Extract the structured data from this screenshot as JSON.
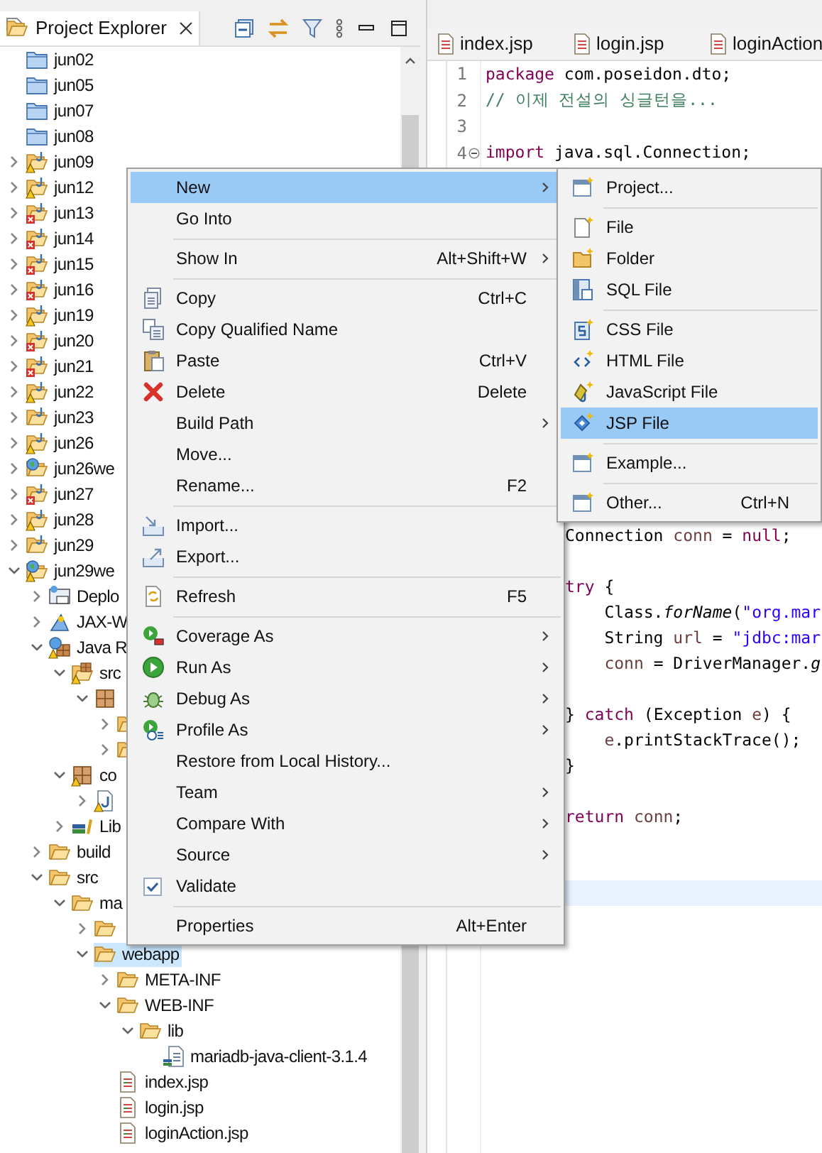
{
  "explorer": {
    "title": "Project Explorer",
    "tree": [
      {
        "label": "jun02",
        "kind": "closed-project",
        "selected": false
      },
      {
        "label": "jun05",
        "kind": "closed-project",
        "selected": false
      },
      {
        "label": "jun07",
        "kind": "closed-project",
        "selected": false
      },
      {
        "label": "jun08",
        "kind": "closed-project",
        "selected": false
      },
      {
        "label": "jun09",
        "kind": "project",
        "warning": true,
        "error": false,
        "expanded": false,
        "selected": false
      },
      {
        "label": "jun12",
        "kind": "project",
        "warning": true,
        "error": false,
        "expanded": false,
        "selected": false
      },
      {
        "label": "jun13",
        "kind": "project",
        "warning": false,
        "error": true,
        "expanded": false,
        "selected": false
      },
      {
        "label": "jun14",
        "kind": "project",
        "warning": false,
        "error": true,
        "expanded": false,
        "selected": false
      },
      {
        "label": "jun15",
        "kind": "project",
        "warning": false,
        "error": true,
        "expanded": false,
        "selected": false
      },
      {
        "label": "jun16",
        "kind": "project",
        "warning": false,
        "error": true,
        "expanded": false,
        "selected": false
      },
      {
        "label": "jun19",
        "kind": "project",
        "warning": true,
        "error": false,
        "expanded": false,
        "selected": false
      },
      {
        "label": "jun20",
        "kind": "project",
        "warning": false,
        "error": true,
        "expanded": false,
        "selected": false
      },
      {
        "label": "jun21",
        "kind": "project",
        "warning": false,
        "error": true,
        "expanded": false,
        "selected": false
      },
      {
        "label": "jun22",
        "kind": "project",
        "warning": true,
        "error": false,
        "expanded": false,
        "selected": false
      },
      {
        "label": "jun23",
        "kind": "project",
        "warning": false,
        "error": false,
        "expanded": false,
        "selected": false
      },
      {
        "label": "jun26",
        "kind": "project",
        "warning": true,
        "error": false,
        "expanded": false,
        "selected": false
      },
      {
        "label": "jun26we",
        "kind": "web-project",
        "warning": false,
        "error": false,
        "expanded": false,
        "selected": false
      },
      {
        "label": "jun27",
        "kind": "project",
        "warning": false,
        "error": true,
        "expanded": false,
        "selected": false
      },
      {
        "label": "jun28",
        "kind": "project",
        "warning": true,
        "error": false,
        "expanded": false,
        "selected": false
      },
      {
        "label": "jun29",
        "kind": "project",
        "warning": false,
        "error": false,
        "expanded": false,
        "selected": false
      },
      {
        "label": "jun29we",
        "kind": "web-project",
        "warning": true,
        "error": false,
        "expanded": true,
        "selected": false,
        "children": [
          {
            "label": "Deplo",
            "kind": "deploy",
            "warning": false,
            "error": false,
            "expanded": false,
            "selected": false
          },
          {
            "label": "JAX-W",
            "kind": "jax",
            "warning": false,
            "error": false,
            "expanded": false,
            "selected": false
          },
          {
            "label": "Java R",
            "kind": "java-resources",
            "warning": true,
            "error": false,
            "expanded": true,
            "selected": false,
            "children": [
              {
                "label": "src",
                "kind": "source-folder",
                "warning": true,
                "error": false,
                "expanded": true,
                "selected": false,
                "children": [
                  {
                    "kind": "package",
                    "warning": false,
                    "error": false,
                    "expanded": true,
                    "selected": false,
                    "children": [
                      {
                        "kind": "package-folder",
                        "warning": false,
                        "error": false,
                        "expanded": false,
                        "selected": false
                      },
                      {
                        "kind": "package-folder",
                        "warning": false,
                        "error": false,
                        "expanded": false,
                        "selected": false
                      }
                    ]
                  }
                ]
              },
              {
                "label": "co",
                "kind": "package",
                "warning": true,
                "error": false,
                "expanded": true,
                "selected": false,
                "children": [
                  {
                    "kind": "java-file",
                    "warning": true,
                    "error": false,
                    "expanded": false,
                    "selected": false
                  }
                ]
              },
              {
                "label": "Lib",
                "kind": "library",
                "warning": false,
                "error": false,
                "expanded": false,
                "selected": false
              }
            ]
          },
          {
            "label": "build",
            "kind": "folder",
            "warning": false,
            "error": false,
            "expanded": false,
            "selected": false
          },
          {
            "label": "src",
            "kind": "folder",
            "warning": false,
            "error": false,
            "expanded": true,
            "selected": false,
            "children": [
              {
                "label": "ma",
                "kind": "folder",
                "warning": false,
                "error": false,
                "expanded": true,
                "selected": false,
                "children": [
                  {
                    "kind": "folder",
                    "warning": false,
                    "error": false,
                    "expanded": false,
                    "selected": false
                  },
                  {
                    "label": "webapp",
                    "kind": "folder",
                    "warning": false,
                    "error": false,
                    "expanded": true,
                    "selected": true,
                    "children": [
                      {
                        "label": "META-INF",
                        "kind": "folder",
                        "warning": false,
                        "error": false,
                        "expanded": false,
                        "selected": false
                      },
                      {
                        "label": "WEB-INF",
                        "kind": "folder",
                        "warning": false,
                        "error": false,
                        "expanded": true,
                        "selected": false,
                        "children": [
                          {
                            "label": "lib",
                            "kind": "folder",
                            "warning": false,
                            "error": false,
                            "expanded": true,
                            "selected": false,
                            "children": [
                              {
                                "label": "mariadb-java-client-3.1.4",
                                "kind": "jar",
                                "warning": false,
                                "error": false,
                                "selected": false
                              }
                            ]
                          }
                        ]
                      },
                      {
                        "label": "index.jsp",
                        "kind": "jsp",
                        "warning": false,
                        "error": false,
                        "selected": false
                      },
                      {
                        "label": "login.jsp",
                        "kind": "jsp",
                        "warning": false,
                        "error": false,
                        "selected": false
                      },
                      {
                        "label": "loginAction.jsp",
                        "kind": "jsp",
                        "warning": false,
                        "error": false,
                        "selected": false
                      }
                    ]
                  }
                ]
              }
            ]
          }
        ]
      }
    ]
  },
  "editor": {
    "tabs": [
      {
        "label": "index.jsp"
      },
      {
        "label": "login.jsp"
      },
      {
        "label": "loginAction"
      }
    ],
    "top_lines": [
      {
        "number": "1",
        "fold": false,
        "tokens": [
          {
            "text": "package",
            "kind": "keyword"
          },
          {
            "text": " com.poseidon.dto;",
            "kind": "plain"
          }
        ]
      },
      {
        "number": "2",
        "fold": false,
        "tokens": [
          {
            "text": "// 이제 전설의 싱글턴을...",
            "kind": "comment"
          }
        ]
      },
      {
        "number": "3",
        "fold": false
      },
      {
        "number": "4",
        "fold": true,
        "tokens": [
          {
            "text": "import",
            "kind": "keyword"
          },
          {
            "text": " java.sql.Connection;",
            "kind": "plain"
          }
        ]
      }
    ],
    "lower_lines": [
      {
        "kind": "code",
        "tokens": [
          {
            "text": "Connection ",
            "kind": "plain"
          },
          {
            "text": "conn",
            "kind": "variable"
          },
          {
            "text": " = ",
            "kind": "plain"
          },
          {
            "text": "null",
            "kind": "keyword"
          },
          {
            "text": ";",
            "kind": "plain"
          }
        ]
      },
      {
        "kind": "blank"
      },
      {
        "kind": "code",
        "tokens": [
          {
            "text": "try",
            "kind": "keyword"
          },
          {
            "text": " {",
            "kind": "plain"
          }
        ]
      },
      {
        "kind": "indented",
        "tokens": [
          {
            "text": "Class.",
            "kind": "plain"
          },
          {
            "text": "forName",
            "kind": "static"
          },
          {
            "text": "(",
            "kind": "plain"
          },
          {
            "text": "\"org.mar",
            "kind": "string"
          }
        ]
      },
      {
        "kind": "indented",
        "tokens": [
          {
            "text": "String ",
            "kind": "plain"
          },
          {
            "text": "url",
            "kind": "variable"
          },
          {
            "text": " = ",
            "kind": "plain"
          },
          {
            "text": "\"jdbc:mar",
            "kind": "string"
          }
        ]
      },
      {
        "kind": "indented",
        "tokens": [
          {
            "text": "conn",
            "kind": "variable"
          },
          {
            "text": " = DriverManager.",
            "kind": "plain"
          },
          {
            "text": "g",
            "kind": "static"
          }
        ]
      },
      {
        "kind": "blank"
      },
      {
        "kind": "code",
        "tokens": [
          {
            "text": "} ",
            "kind": "plain"
          },
          {
            "text": "catch",
            "kind": "keyword"
          },
          {
            "text": " (Exception ",
            "kind": "plain"
          },
          {
            "text": "e",
            "kind": "variable"
          },
          {
            "text": ") {",
            "kind": "plain"
          }
        ]
      },
      {
        "kind": "indented",
        "tokens": [
          {
            "text": "e",
            "kind": "variable"
          },
          {
            "text": ".printStackTrace();",
            "kind": "plain"
          }
        ]
      },
      {
        "kind": "code",
        "tokens": [
          {
            "text": "}",
            "kind": "plain"
          }
        ]
      },
      {
        "kind": "blank"
      },
      {
        "kind": "code",
        "tokens": [
          {
            "text": "return",
            "kind": "keyword"
          },
          {
            "text": " conn",
            "kind": "variable"
          },
          {
            "text": ";",
            "kind": "plain"
          }
        ]
      },
      {
        "kind": "blank"
      },
      {
        "kind": "blank"
      },
      {
        "kind": "current"
      }
    ]
  },
  "context_menu": {
    "items": [
      {
        "kind": "item",
        "label": "New",
        "submenu": true,
        "selected": true
      },
      {
        "kind": "item",
        "label": "Go Into",
        "submenu": false,
        "selected": false
      },
      {
        "kind": "separator"
      },
      {
        "kind": "item",
        "label": "Show In",
        "shortcut": "Alt+Shift+W",
        "submenu": true,
        "selected": false
      },
      {
        "kind": "separator"
      },
      {
        "kind": "copy",
        "label": "Copy",
        "shortcut": "Ctrl+C",
        "submenu": false,
        "selected": false
      },
      {
        "kind": "copy-qualified",
        "label": "Copy Qualified Name",
        "submenu": false,
        "selected": false
      },
      {
        "kind": "paste",
        "label": "Paste",
        "shortcut": "Ctrl+V",
        "submenu": false,
        "selected": false
      },
      {
        "kind": "delete",
        "label": "Delete",
        "shortcut": "Delete",
        "submenu": false,
        "selected": false
      },
      {
        "kind": "item",
        "label": "Build Path",
        "submenu": true,
        "selected": false
      },
      {
        "kind": "item",
        "label": "Move...",
        "submenu": false,
        "selected": false
      },
      {
        "kind": "item",
        "label": "Rename...",
        "shortcut": "F2",
        "submenu": false,
        "selected": false
      },
      {
        "kind": "separator"
      },
      {
        "kind": "import",
        "label": "Import...",
        "submenu": false,
        "selected": false
      },
      {
        "kind": "export",
        "label": "Export...",
        "submenu": false,
        "selected": false
      },
      {
        "kind": "separator"
      },
      {
        "kind": "refresh",
        "label": "Refresh",
        "shortcut": "F5",
        "submenu": false,
        "selected": false
      },
      {
        "kind": "separator"
      },
      {
        "kind": "coverage",
        "label": "Coverage As",
        "submenu": true,
        "selected": false
      },
      {
        "kind": "run",
        "label": "Run As",
        "submenu": true,
        "selected": false
      },
      {
        "kind": "debug",
        "label": "Debug As",
        "submenu": true,
        "selected": false
      },
      {
        "kind": "profile",
        "label": "Profile As",
        "submenu": true,
        "selected": false
      },
      {
        "kind": "item",
        "label": "Restore from Local History...",
        "submenu": false,
        "selected": false
      },
      {
        "kind": "item",
        "label": "Team",
        "submenu": true,
        "selected": false
      },
      {
        "kind": "item",
        "label": "Compare With",
        "submenu": true,
        "selected": false
      },
      {
        "kind": "item",
        "label": "Source",
        "submenu": true,
        "selected": false
      },
      {
        "kind": "check",
        "label": "Validate",
        "submenu": false,
        "selected": false
      },
      {
        "kind": "separator"
      },
      {
        "kind": "item",
        "label": "Properties",
        "shortcut": "Alt+Enter",
        "submenu": false,
        "selected": false
      }
    ]
  },
  "submenu": {
    "items": [
      {
        "kind": "project",
        "label": "Project...",
        "selected": false
      },
      {
        "kind": "separator"
      },
      {
        "kind": "file",
        "label": "File",
        "selected": false
      },
      {
        "kind": "folder",
        "label": "Folder",
        "selected": false
      },
      {
        "kind": "sql",
        "label": "SQL File",
        "selected": false
      },
      {
        "kind": "separator"
      },
      {
        "kind": "css",
        "label": "CSS File",
        "selected": false
      },
      {
        "kind": "html",
        "label": "HTML File",
        "selected": false
      },
      {
        "kind": "javascript",
        "label": "JavaScript File",
        "selected": false
      },
      {
        "kind": "jsp",
        "label": "JSP File",
        "selected": true
      },
      {
        "kind": "separator"
      },
      {
        "kind": "project",
        "label": "Example...",
        "selected": false
      },
      {
        "kind": "separator"
      },
      {
        "kind": "project",
        "label": "Other...",
        "shortcut": "Ctrl+N",
        "selected": false
      }
    ]
  }
}
